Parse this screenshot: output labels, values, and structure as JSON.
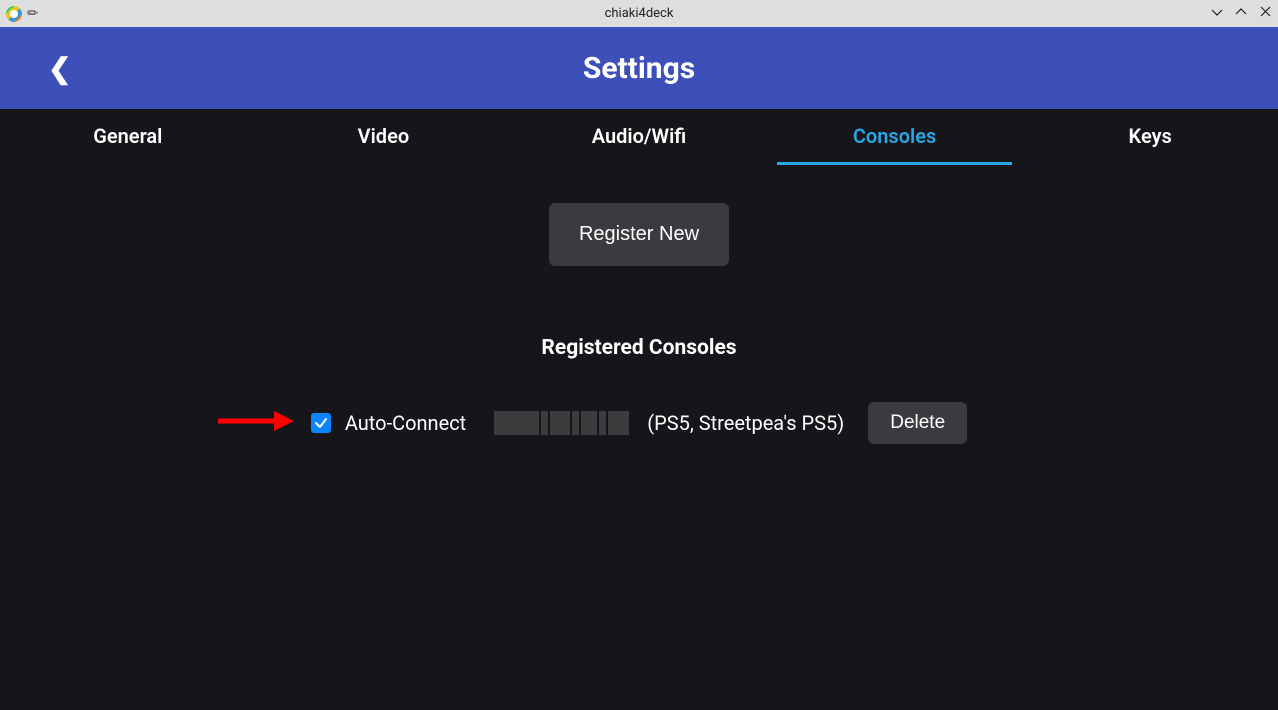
{
  "window": {
    "title": "chiaki4deck"
  },
  "header": {
    "title": "Settings"
  },
  "tabs": {
    "general": "General",
    "video": "Video",
    "audiowifi": "Audio/Wifi",
    "consoles": "Consoles",
    "keys": "Keys",
    "active": "consoles"
  },
  "buttons": {
    "register_new": "Register New",
    "delete": "Delete"
  },
  "sections": {
    "registered_consoles": "Registered Consoles"
  },
  "console_entry": {
    "auto_connect_label": "Auto-Connect",
    "auto_connect_checked": true,
    "description": "(PS5, Streetpea's PS5)"
  }
}
